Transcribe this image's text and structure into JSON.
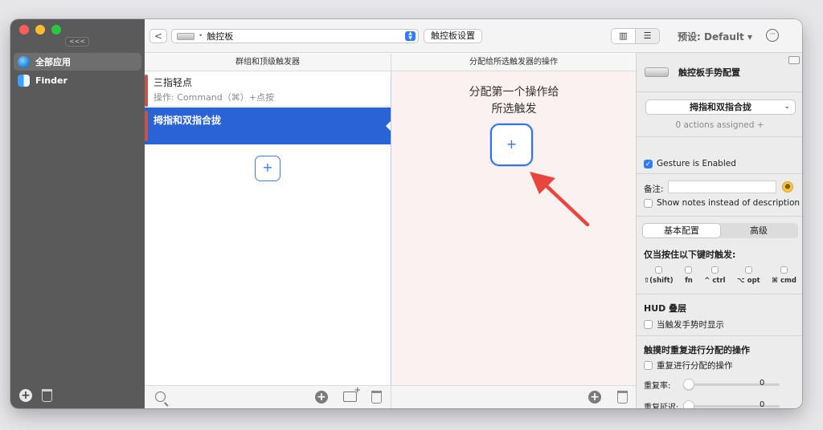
{
  "sidebar": {
    "collapse_label": "<<<",
    "apps": [
      {
        "name": "全部应用",
        "icon": "globe-icon"
      },
      {
        "name": "Finder",
        "icon": "finder-icon"
      }
    ]
  },
  "toolbar": {
    "back_label": "<",
    "device_label": "触控板",
    "device_separator": "•",
    "settings_label": "触控板设置",
    "view_toggle": [
      "▥",
      "☰"
    ],
    "preset_label": "预设: Default ▾",
    "more_label": "···"
  },
  "columns": {
    "triggers_header": "群组和顶级触发器",
    "actions_header": "分配给所选触发器的操作"
  },
  "triggers": [
    {
      "title": "三指轻点",
      "subtitle": "操作: Command（⌘）+点按",
      "selected": false
    },
    {
      "title": "拇指和双指合拢",
      "subtitle": "",
      "selected": true
    }
  ],
  "add_trigger_label": "+",
  "actions_panel": {
    "prompt_line1": "分配第一个操作给",
    "prompt_line2": "所选触发",
    "add_label": "+"
  },
  "bottom": {
    "plus_label": "+"
  },
  "inspector": {
    "title": "触控板手势配置",
    "gesture_value": "拇指和双指合拢",
    "gesture_chevron": "⌄",
    "assigned_text": "0 actions assigned +",
    "enabled_label": "Gesture is Enabled",
    "enabled_checked": true,
    "notes_label": "备注:",
    "notes_value": "",
    "emoji": "☻",
    "show_notes_label": "Show notes instead of description",
    "tabs": [
      "基本配置",
      "高级"
    ],
    "modifier_title": "仅当按住以下键时触发:",
    "modifiers": [
      "⇧(shift)",
      "fn",
      "^ ctrl",
      "⌥ opt",
      "⌘ cmd"
    ],
    "hud_title": "HUD 叠层",
    "hud_option": "当触发手势时显示",
    "repeat_title": "触摸时重复进行分配的操作",
    "repeat_option": "重复进行分配的操作",
    "repeat_rate_label": "重复率:",
    "repeat_rate_value": "0",
    "repeat_delay_label": "重复延迟:",
    "repeat_delay_value": "0"
  },
  "colors": {
    "selection": "#2a63d6",
    "accent": "#2f7cf6",
    "arrow": "#e8453c",
    "sidebar": "#5a5a5a"
  }
}
